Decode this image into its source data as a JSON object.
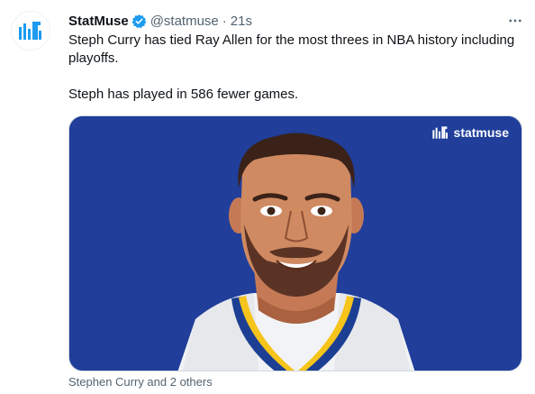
{
  "tweet": {
    "display_name": "StatMuse",
    "handle": "@statmuse",
    "separator": "·",
    "time": "21s",
    "more_icon": "more-horizontal-icon",
    "verified_icon": "verified-badge-icon",
    "text_line_1": "Steph Curry has tied Ray Allen for the most threes in NBA history including playoffs.",
    "text_line_2": "Steph has played in 586 fewer games."
  },
  "media": {
    "brand_label": "statmuse",
    "brand_icon": "statmuse-logo-icon",
    "background_color": "#203e9a"
  },
  "tags": {
    "label": "Stephen Curry and 2 others"
  },
  "colors": {
    "brand_blue": "#1d9bf0",
    "muted": "#536471",
    "text": "#0f1419"
  }
}
